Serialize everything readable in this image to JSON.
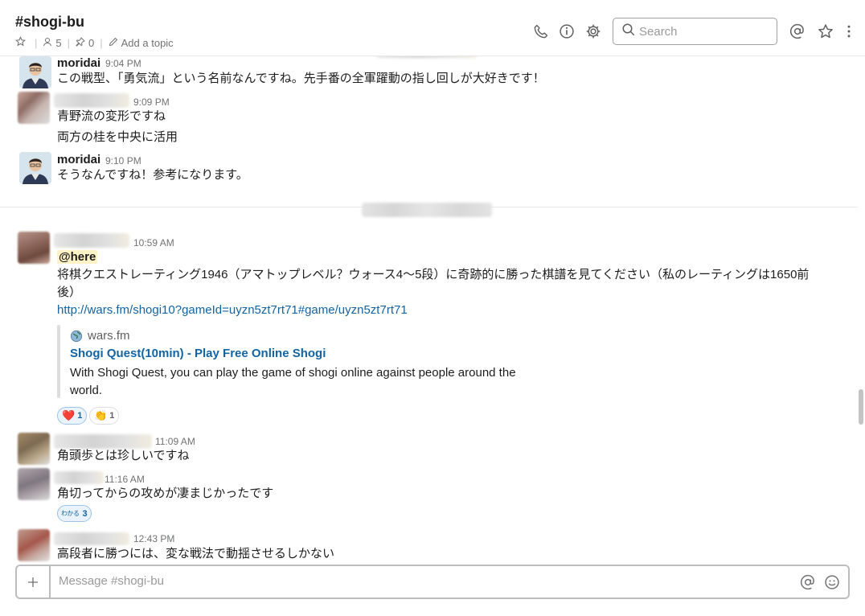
{
  "channel": {
    "name": "#shogi-bu",
    "members": "5",
    "pins": "0",
    "add_topic": "Add a topic"
  },
  "search": {
    "placeholder": "Search"
  },
  "messages": [
    {
      "user": "moridai",
      "time": "9:04 PM",
      "lines": [
        "この戦型、「勇気流」という名前なんですね。先手番の全軍躍動の指し回しが大好きです！"
      ]
    },
    {
      "user": "",
      "time": "9:09 PM",
      "lines": [
        "青野流の変形ですね",
        "両方の桂を中央に活用"
      ]
    },
    {
      "user": "moridai",
      "time": "9:10 PM",
      "lines": [
        "そうなんですね！参考になります。"
      ]
    },
    {
      "user": "",
      "time": "10:59 AM",
      "mention": "@here",
      "lines": [
        "将棋クエストレーティング1946（アマトップレベル？ウォース4〜5段）に奇跡的に勝った棋譜を見てください（私のレーティングは1650前後）"
      ],
      "link": "http://wars.fm/shogi10?gameId=uyzn5zt7rt71#game/uyzn5zt7rt71",
      "attachment": {
        "site": "wars.fm",
        "title": "Shogi Quest(10min) - Play Free Online Shogi",
        "description": "With Shogi Quest, you can play the game of shogi online against people around the world."
      },
      "reactions": [
        {
          "emoji": "❤️",
          "count": "1"
        },
        {
          "emoji": "👏",
          "count": "1"
        }
      ]
    },
    {
      "user": "",
      "time": "11:09 AM",
      "lines": [
        "角頭歩とは珍しいですね"
      ]
    },
    {
      "user": "",
      "time": "11:16 AM",
      "lines": [
        "角切ってからの攻めが凄まじかったです"
      ],
      "reactions": [
        {
          "emoji": "わかる",
          "count": "3"
        }
      ]
    },
    {
      "user": "",
      "time": "12:43 PM",
      "lines": [
        "高段者に勝つには、変な戦法で動揺させるしかない"
      ]
    }
  ],
  "composer": {
    "placeholder": "Message #shogi-bu"
  },
  "colors": {
    "link": "#1264a3",
    "mention_bg": "#fff3c6",
    "border": "#bdbdbf"
  }
}
